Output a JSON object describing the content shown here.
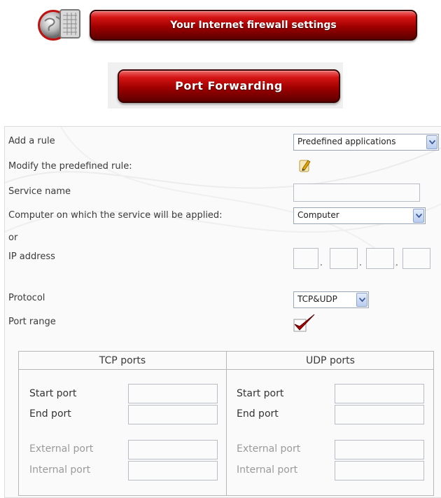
{
  "header": {
    "title": "Your Internet firewall settings",
    "section": "Port Forwarding"
  },
  "form": {
    "add_rule_label": "Add a rule",
    "add_rule_value": "Predefined applications",
    "modify_label": "Modify the predefined rule:",
    "service_name_label": "Service name",
    "service_name_value": "",
    "computer_label": "Computer on which the service will be applied:",
    "computer_value": "Computer",
    "or_label": "or",
    "ip_label": "IP address",
    "ip_octets": [
      "",
      "",
      "",
      ""
    ],
    "protocol_label": "Protocol",
    "protocol_value": "TCP&UDP",
    "port_range_label": "Port range",
    "port_range_checked": true
  },
  "ports": {
    "tcp_header": "TCP ports",
    "udp_header": "UDP ports",
    "start_label": "Start port",
    "end_label": "End port",
    "external_label": "External port",
    "internal_label": "Internal port"
  },
  "colors": {
    "accent_red": "#b00000",
    "select_arrow": "#b9cdef",
    "checkmark": "#b00000"
  },
  "icons": [
    "globe-firewall-icon",
    "edit-pencil-icon",
    "chevron-down-icon",
    "checkmark-icon"
  ]
}
